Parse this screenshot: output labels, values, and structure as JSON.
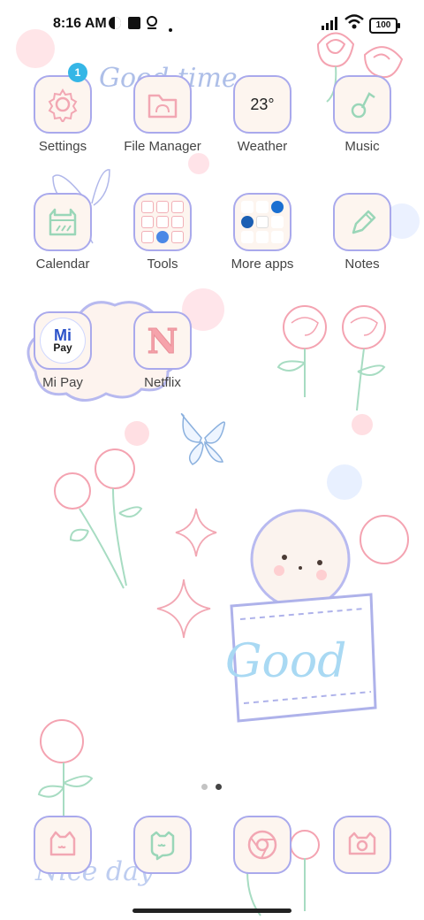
{
  "status_bar": {
    "time": "8:16 AM",
    "battery": "100"
  },
  "wallpaper": {
    "top_text": "Good time",
    "bag_text": "Good",
    "bottom_text": "Nice day"
  },
  "apps": {
    "settings": {
      "label": "Settings",
      "badge": "1"
    },
    "file_manager": {
      "label": "File Manager"
    },
    "weather": {
      "label": "Weather",
      "temperature": "23°"
    },
    "music": {
      "label": "Music"
    },
    "calendar": {
      "label": "Calendar"
    },
    "tools": {
      "label": "Tools"
    },
    "more_apps": {
      "label": "More apps"
    },
    "notes": {
      "label": "Notes"
    },
    "mi_pay": {
      "label": "Mi Pay",
      "logo_top": "Mi",
      "logo_bottom": "Pay"
    },
    "netflix": {
      "label": "Netflix",
      "logo": "N"
    }
  },
  "page_indicator": {
    "pages": 2,
    "active_page": 2
  },
  "colors": {
    "tile_bg": "#fdf5ef",
    "tile_border": "#a9a9ec",
    "pink": "#f6a3ab",
    "green": "#9ad6b8",
    "badge": "#35b6e6"
  }
}
